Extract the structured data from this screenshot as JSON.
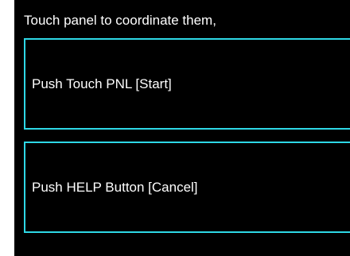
{
  "prompt": {
    "text": "Touch panel to coordinate them,"
  },
  "buttons": {
    "start_label": "Push Touch PNL [Start]",
    "cancel_label": "Push HELP Button [Cancel]"
  },
  "colors": {
    "background": "#000000",
    "text": "#ffffff",
    "button_border": "#2ed8e6"
  }
}
